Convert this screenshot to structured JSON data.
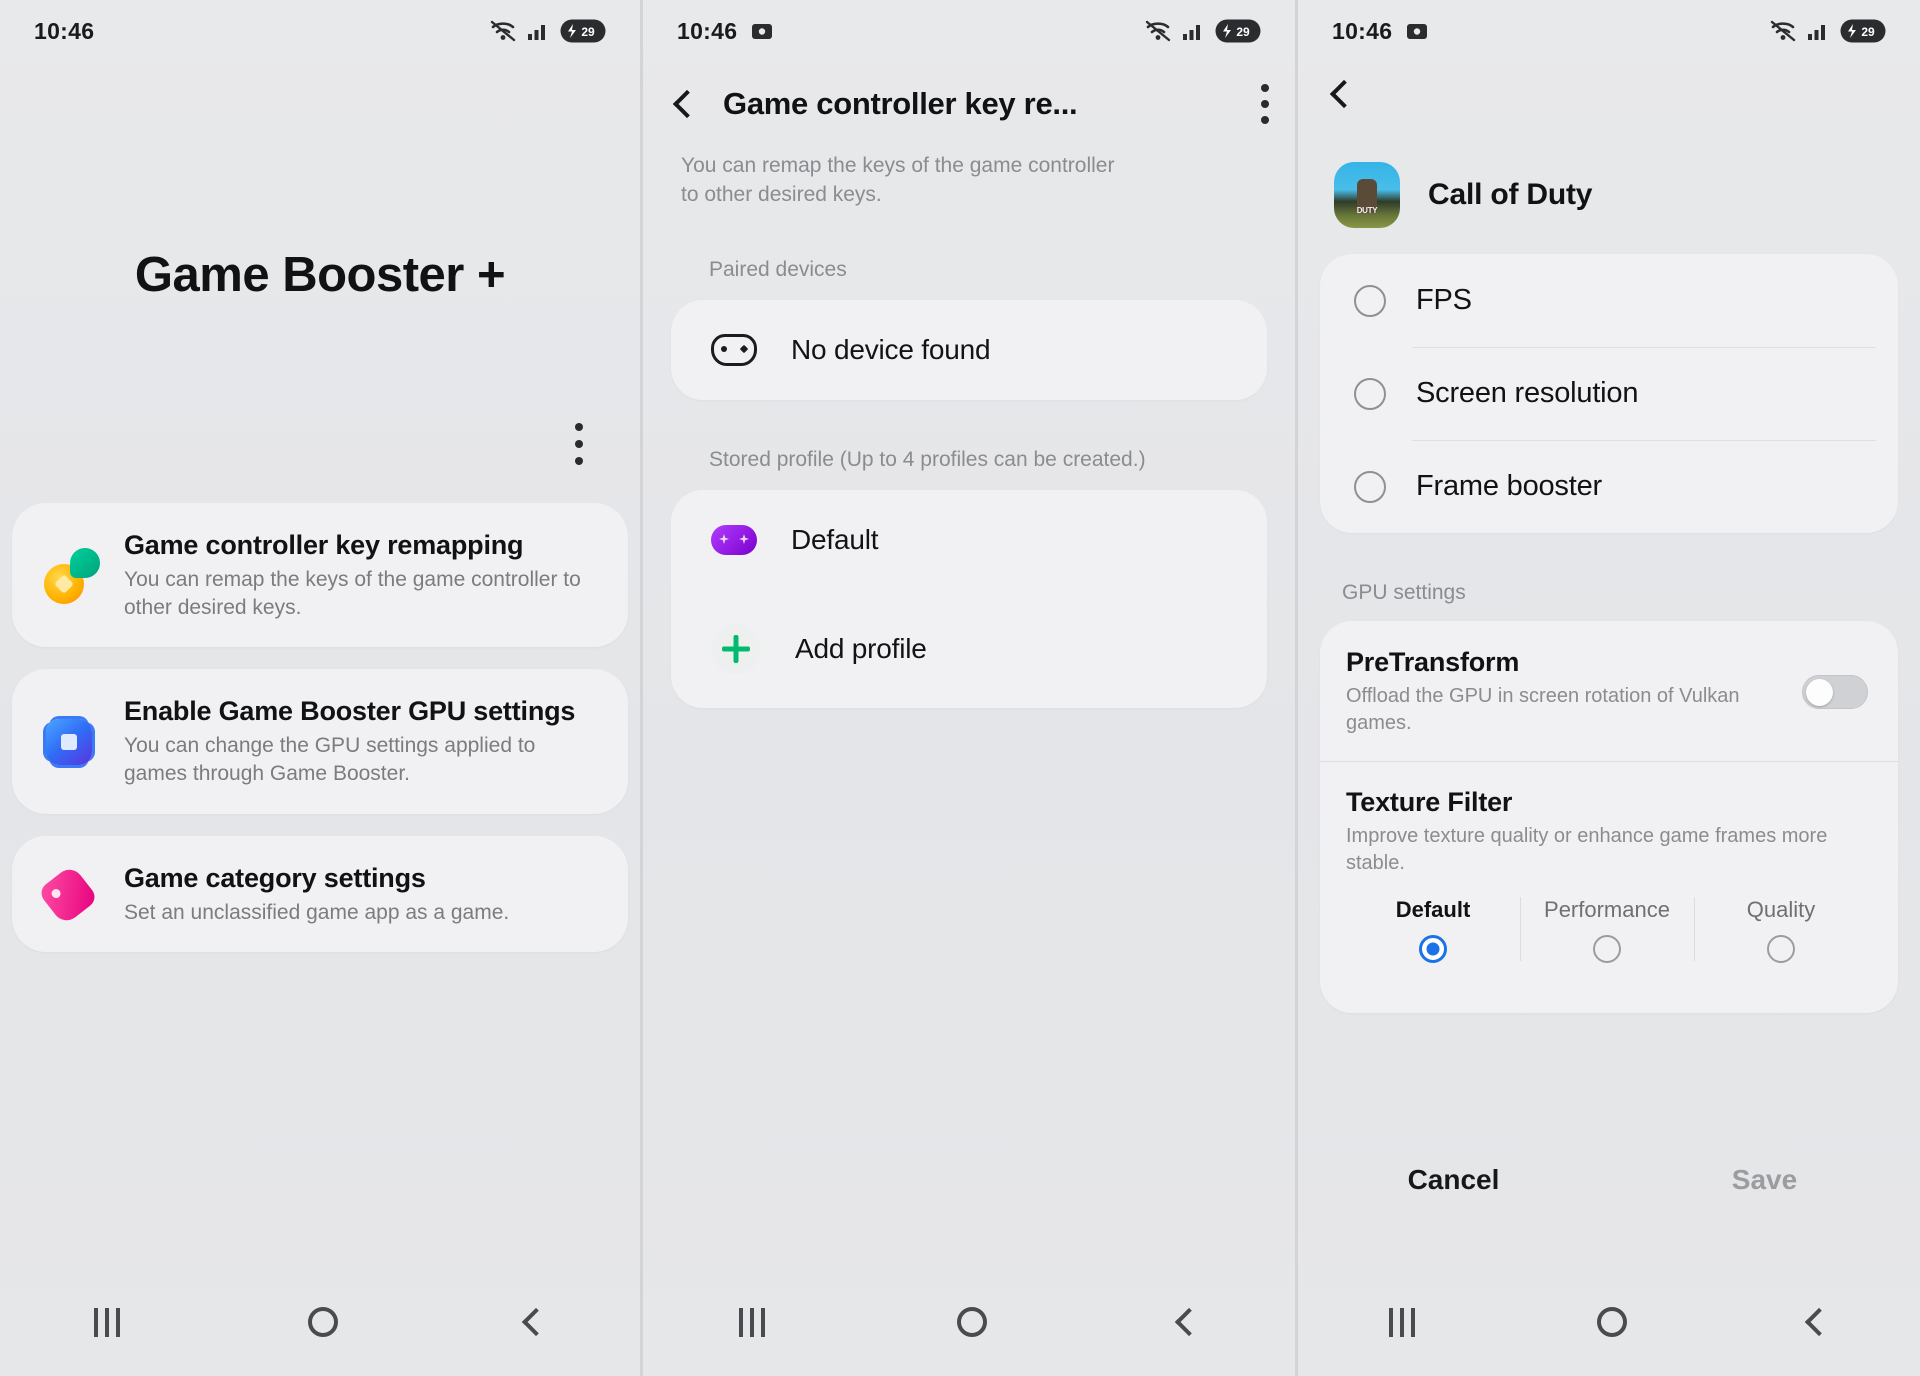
{
  "status_bar": {
    "time": "10:46",
    "icons": [
      "screenshot-icon",
      "wifi-icon",
      "signal-icon",
      "battery-icon"
    ],
    "battery_label": "29"
  },
  "panel1": {
    "title": "Game Booster +",
    "overflow_menu": "kebab-menu-icon",
    "cards": [
      {
        "icon": "remap-keys-icon",
        "title": "Game controller key remapping",
        "subtitle": "You can remap the keys of the game controller to other desired keys."
      },
      {
        "icon": "gpu-chip-icon",
        "title": "Enable Game Booster GPU settings",
        "subtitle": "You can change the GPU settings applied to games through Game Booster."
      },
      {
        "icon": "category-tag-icon",
        "title": "Game category settings",
        "subtitle": "Set an unclassified game app as a game."
      }
    ]
  },
  "panel2": {
    "back": "back-arrow-icon",
    "title": "Game controller key re...",
    "overflow_menu": "kebab-menu-icon",
    "description": "You can remap the keys of the game controller to other desired keys.",
    "paired_devices_label": "Paired devices",
    "paired_devices": [
      {
        "icon": "gamepad-icon",
        "label": "No device found"
      }
    ],
    "stored_profile_label": "Stored profile (Up to 4 profiles can be created.)",
    "profiles": [
      {
        "icon": "gamepad-purple-icon",
        "label": "Default"
      },
      {
        "icon": "plus-icon",
        "label": "Add profile"
      }
    ]
  },
  "panel3": {
    "back": "back-arrow-icon",
    "app_name": "Call of Duty",
    "app_icon": "call-of-duty-app-icon",
    "app_icon_word": "DUTY",
    "options": [
      {
        "label": "FPS",
        "selected": false
      },
      {
        "label": "Screen resolution",
        "selected": false
      },
      {
        "label": "Frame booster",
        "selected": false
      }
    ],
    "gpu_settings_label": "GPU settings",
    "gpu_items": [
      {
        "title": "PreTransform",
        "subtitle": "Offload the GPU in screen rotation of Vulkan games.",
        "toggle_on": false
      },
      {
        "title": "Texture Filter",
        "subtitle": "Improve texture quality or enhance game frames more stable."
      }
    ],
    "texture_filter_options": [
      {
        "label": "Default",
        "selected": true
      },
      {
        "label": "Performance",
        "selected": false
      },
      {
        "label": "Quality",
        "selected": false
      }
    ],
    "actions": {
      "cancel": "Cancel",
      "save": "Save"
    }
  },
  "navigation": {
    "recents": "recents-icon",
    "home": "home-icon",
    "back": "back-icon"
  },
  "colors": {
    "accent_blue": "#1a73e8",
    "card_bg": "#f1f1f3",
    "screen_bg": "#e6e7e9",
    "muted_text": "#8b8c90"
  }
}
